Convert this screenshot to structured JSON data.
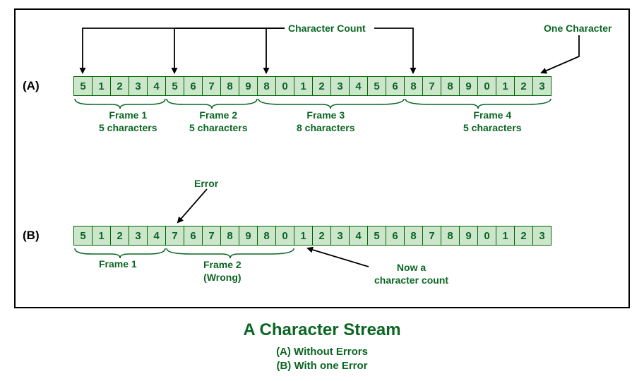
{
  "labels": {
    "charCount": "Character Count",
    "oneChar": "One Character",
    "error": "Error",
    "nowCount": "Now a\ncharacter count",
    "rowA": "(A)",
    "rowB": "(B)",
    "frameA1": "Frame 1\n5 characters",
    "frameA2": "Frame 2\n5 characters",
    "frameA3": "Frame 3\n8 characters",
    "frameA4": "Frame 4\n5 characters",
    "frameB1": "Frame 1",
    "frameB2": "Frame 2\n(Wrong)"
  },
  "streamA": [
    "5",
    "1",
    "2",
    "3",
    "4",
    "5",
    "6",
    "7",
    "8",
    "9",
    "8",
    "0",
    "1",
    "2",
    "3",
    "4",
    "5",
    "6",
    "8",
    "7",
    "8",
    "9",
    "0",
    "1",
    "2",
    "3"
  ],
  "streamB": [
    "5",
    "1",
    "2",
    "3",
    "4",
    "7",
    "6",
    "7",
    "8",
    "9",
    "8",
    "0",
    "1",
    "2",
    "3",
    "4",
    "5",
    "6",
    "8",
    "7",
    "8",
    "9",
    "0",
    "1",
    "2",
    "3"
  ],
  "title": {
    "main": "A Character Stream",
    "subA": "(A) Without Errors",
    "subB": "(B) With one Error"
  }
}
